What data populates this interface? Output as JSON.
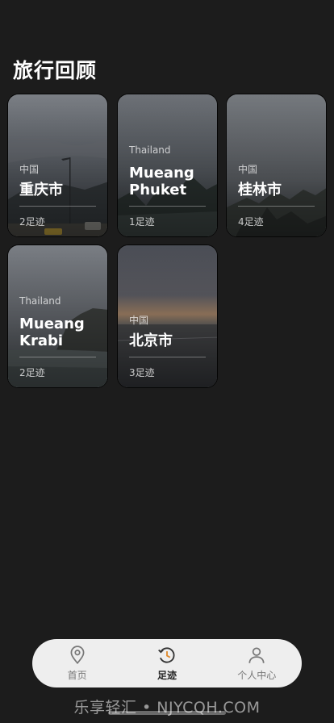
{
  "header": {
    "title": "旅行回顾"
  },
  "cards": [
    {
      "country": "中国",
      "city": "重庆市",
      "count": "2足迹"
    },
    {
      "country": "Thailand",
      "city": "Mueang Phuket",
      "count": "1足迹"
    },
    {
      "country": "中国",
      "city": "桂林市",
      "count": "4足迹"
    },
    {
      "country": "Thailand",
      "city": "Mueang Krabi",
      "count": "2足迹"
    },
    {
      "country": "中国",
      "city": "北京市",
      "count": "3足迹"
    }
  ],
  "tabbar": {
    "items": [
      {
        "label": "首页",
        "icon": "location-pin-icon"
      },
      {
        "label": "足迹",
        "icon": "history-icon",
        "active": true
      },
      {
        "label": "个人中心",
        "icon": "person-icon"
      }
    ]
  },
  "watermark": "乐享轻汇 • NJYCQH.COM"
}
